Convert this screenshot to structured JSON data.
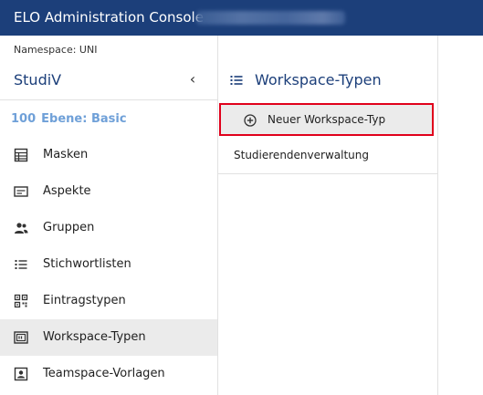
{
  "header": {
    "title": "ELO Administration Console"
  },
  "sidebar": {
    "namespace_label": "Namespace: UNI",
    "title": "StudiV",
    "collapse_glyph": "‹",
    "level": {
      "number": "100",
      "label": "Ebene: Basic"
    },
    "items": [
      {
        "label": "Masken",
        "icon": "form-icon",
        "active": false
      },
      {
        "label": "Aspekte",
        "icon": "card-icon",
        "active": false
      },
      {
        "label": "Gruppen",
        "icon": "people-icon",
        "active": false
      },
      {
        "label": "Stichwortlisten",
        "icon": "list-icon",
        "active": false
      },
      {
        "label": "Eintragstypen",
        "icon": "qr-icon",
        "active": false
      },
      {
        "label": "Workspace-Typen",
        "icon": "workspace-icon",
        "active": true
      },
      {
        "label": "Teamspace-Vorlagen",
        "icon": "teamspace-icon",
        "active": false
      }
    ]
  },
  "main": {
    "title": "Workspace-Typen",
    "new_button_label": "Neuer Workspace-Typ",
    "list": [
      {
        "label": "Studierendenverwaltung"
      }
    ]
  },
  "colors": {
    "header_bg": "#1c3f7a",
    "accent_title": "#1c3f7a",
    "level_blue": "#6fa0d8",
    "highlight_border": "#e0001b",
    "active_bg": "#ebebeb"
  }
}
